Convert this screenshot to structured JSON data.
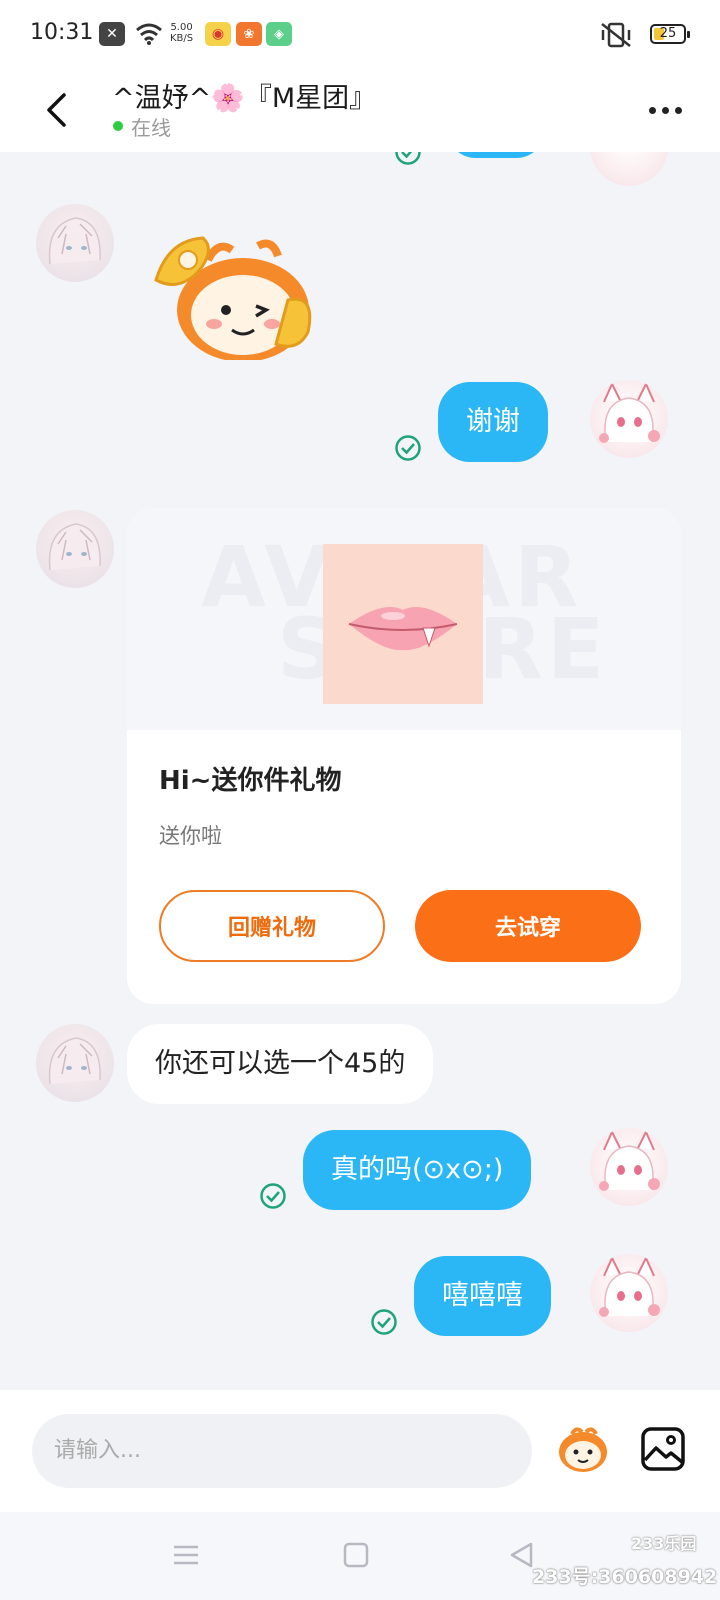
{
  "status_bar": {
    "time": "10:31",
    "net_speed_value": "5.00",
    "net_speed_unit": "KB/S",
    "battery": "25"
  },
  "header": {
    "title": "^温妤^🌸『M星团』",
    "status": "在线"
  },
  "messages": [
    {
      "side": "out",
      "text": "谢谢"
    },
    {
      "side": "in",
      "type": "gift"
    },
    {
      "side": "in",
      "text": "你还可以选一个45的"
    },
    {
      "side": "out",
      "text": "真的吗(⊙x⊙;)"
    },
    {
      "side": "out",
      "text": "嘻嘻嘻"
    }
  ],
  "gift_card": {
    "title": "Hi~送你件礼物",
    "subtitle": "送你啦",
    "return_button": "回赠礼物",
    "try_button": "去试穿",
    "watermark_top": "AVATAR",
    "watermark_bottom": "STORE"
  },
  "input": {
    "placeholder": "请输入..."
  },
  "watermark": {
    "brand": "233乐园",
    "id": "233号:360608942"
  },
  "colors": {
    "outgoing_bubble": "#2bb6f6",
    "accent_orange": "#fb6f16",
    "online_dot": "#2ecc40",
    "read_check": "#1fa37a"
  }
}
